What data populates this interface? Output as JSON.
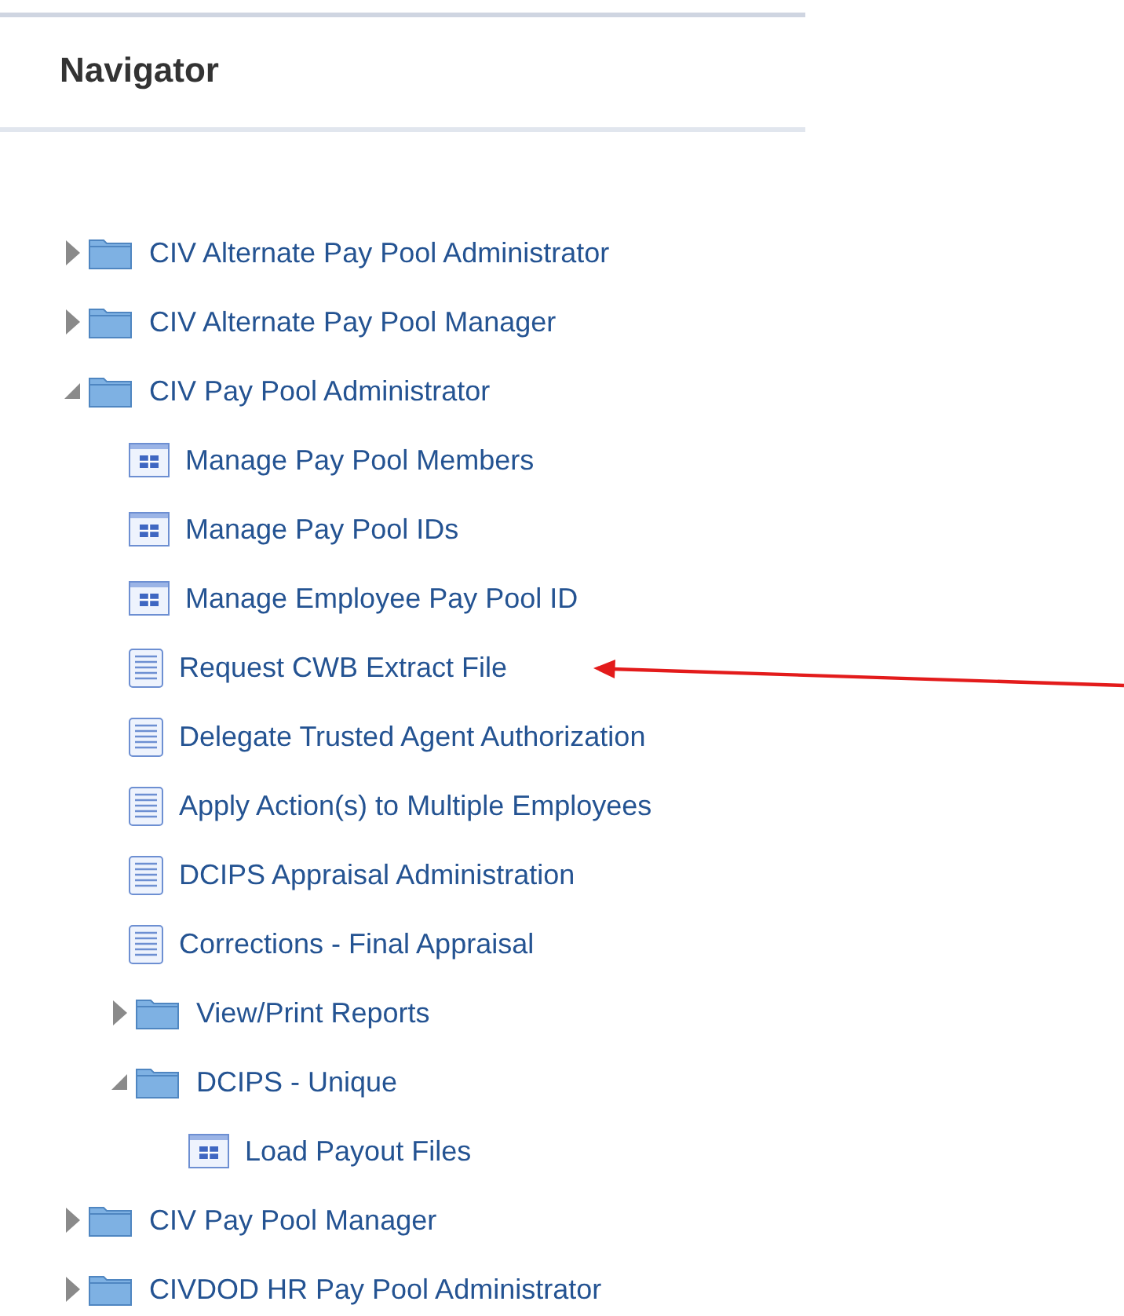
{
  "panel": {
    "title": "Navigator"
  },
  "tree": [
    {
      "kind": "folder",
      "label": "CIV Alternate Pay Pool Administrator",
      "expanded": false
    },
    {
      "kind": "folder",
      "label": "CIV Alternate Pay Pool Manager",
      "expanded": false
    },
    {
      "kind": "folder",
      "label": "CIV Pay Pool Administrator",
      "expanded": true,
      "children": [
        {
          "kind": "form",
          "label": "Manage Pay Pool Members"
        },
        {
          "kind": "form",
          "label": "Manage Pay Pool IDs"
        },
        {
          "kind": "form",
          "label": "Manage Employee Pay Pool ID"
        },
        {
          "kind": "page",
          "label": "Request CWB Extract File"
        },
        {
          "kind": "page",
          "label": "Delegate Trusted Agent Authorization"
        },
        {
          "kind": "page",
          "label": "Apply Action(s) to Multiple Employees"
        },
        {
          "kind": "page",
          "label": "DCIPS Appraisal Administration"
        },
        {
          "kind": "page",
          "label": "Corrections - Final Appraisal"
        },
        {
          "kind": "folder",
          "label": "View/Print Reports",
          "expanded": false
        },
        {
          "kind": "folder",
          "label": "DCIPS - Unique",
          "expanded": true,
          "children": [
            {
              "kind": "form",
              "label": "Load Payout Files"
            }
          ]
        }
      ]
    },
    {
      "kind": "folder",
      "label": "CIV Pay Pool Manager",
      "expanded": false
    },
    {
      "kind": "folder",
      "label": "CIVDOD HR Pay Pool Administrator",
      "expanded": false
    }
  ]
}
